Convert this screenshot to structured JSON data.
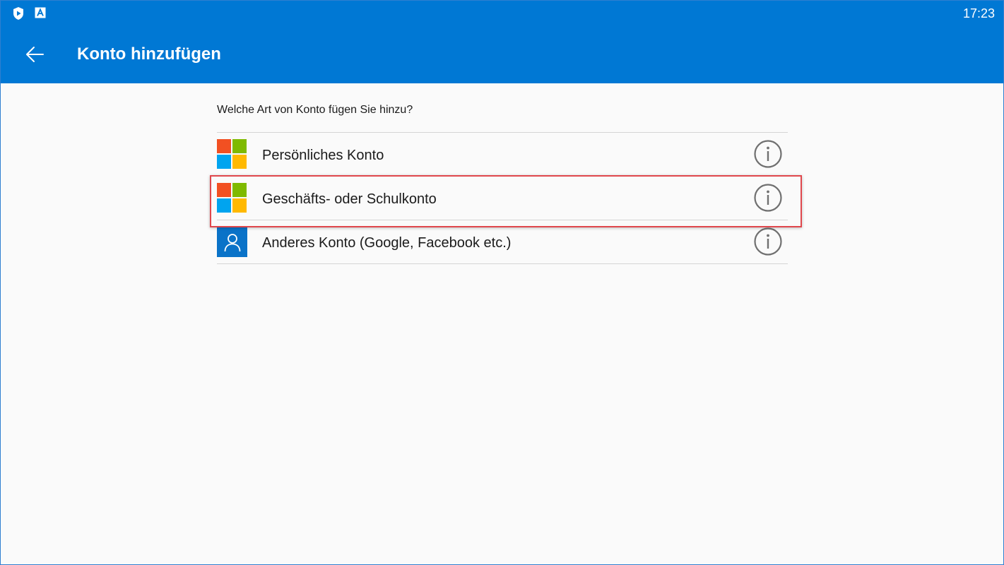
{
  "status_bar": {
    "time": "17:23",
    "icons": [
      "shield-play-icon",
      "app-a-icon"
    ]
  },
  "toolbar": {
    "back_icon": "arrow-left-icon",
    "title": "Konto hinzufügen"
  },
  "question": "Welche Art von Konto fügen Sie hinzu?",
  "accounts": [
    {
      "label": "Persönliches Konto",
      "icon": "microsoft-logo-icon",
      "info_icon": "info-icon"
    },
    {
      "label": "Geschäfts- oder Schulkonto",
      "icon": "microsoft-logo-icon",
      "info_icon": "info-icon",
      "highlighted": true
    },
    {
      "label": "Anderes Konto (Google, Facebook etc.)",
      "icon": "person-icon",
      "info_icon": "info-icon"
    }
  ],
  "colors": {
    "header": "#0078d4",
    "ms_red": "#f25022",
    "ms_green": "#7fba00",
    "ms_blue": "#00a4ef",
    "ms_yellow": "#ffb900",
    "highlight": "#e0474c"
  }
}
